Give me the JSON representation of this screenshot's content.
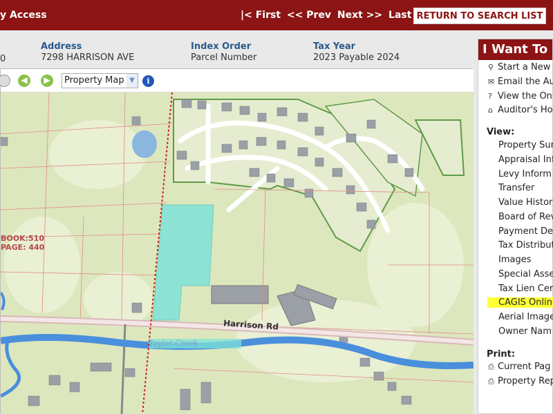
{
  "topbar": {
    "access": "y Access",
    "nav": [
      "|< First",
      "<< Prev",
      "Next >>",
      "Last >|"
    ],
    "return_label": "RETURN TO SEARCH LIST"
  },
  "info": {
    "parcel_frag": "0",
    "address_label": "Address",
    "address_value": "7298 HARRISON AVE",
    "index_label": "Index Order",
    "index_value": "Parcel Number",
    "tax_label": "Tax Year",
    "tax_value": "2023 Payable 2024"
  },
  "map": {
    "select_value": "Property Map",
    "book_label": "BOOK:510",
    "page_label": "PAGE: 440",
    "road_label": "Harrison Rd",
    "creek_label": "Taylor Creek"
  },
  "sidebar": {
    "heading": "I Want To",
    "actions": [
      {
        "icon": "search-icon",
        "glyph": "⚲",
        "label": "Start a New"
      },
      {
        "icon": "email-icon",
        "glyph": "✉",
        "label": "Email the Au"
      },
      {
        "icon": "help-icon",
        "glyph": "?",
        "label": "View the On"
      },
      {
        "icon": "home-icon",
        "glyph": "⌂",
        "label": "Auditor's Ho"
      }
    ],
    "view_label": "View:",
    "views": [
      "Property Sur",
      "Appraisal Inf",
      "Levy Inform",
      "Transfer",
      "Value Histor",
      "Board of Rev",
      "Payment De",
      "Tax Distribut",
      "Images",
      "Special Asse",
      "Tax Lien Cer",
      "CAGIS Onlin",
      "Aerial Image",
      "Owner Nam"
    ],
    "highlighted_view": "CAGIS Onlin",
    "print_label": "Print:",
    "prints": [
      {
        "icon": "printer-icon",
        "glyph": "⎙",
        "label": "Current Pag"
      },
      {
        "icon": "printer-icon",
        "glyph": "⎙",
        "label": "Property Rep"
      }
    ]
  },
  "colors": {
    "header_red": "#8c1414",
    "label_blue": "#2a5a8c",
    "highlight": "#ffff3a",
    "parcel_cyan": "#7fe3d8"
  }
}
